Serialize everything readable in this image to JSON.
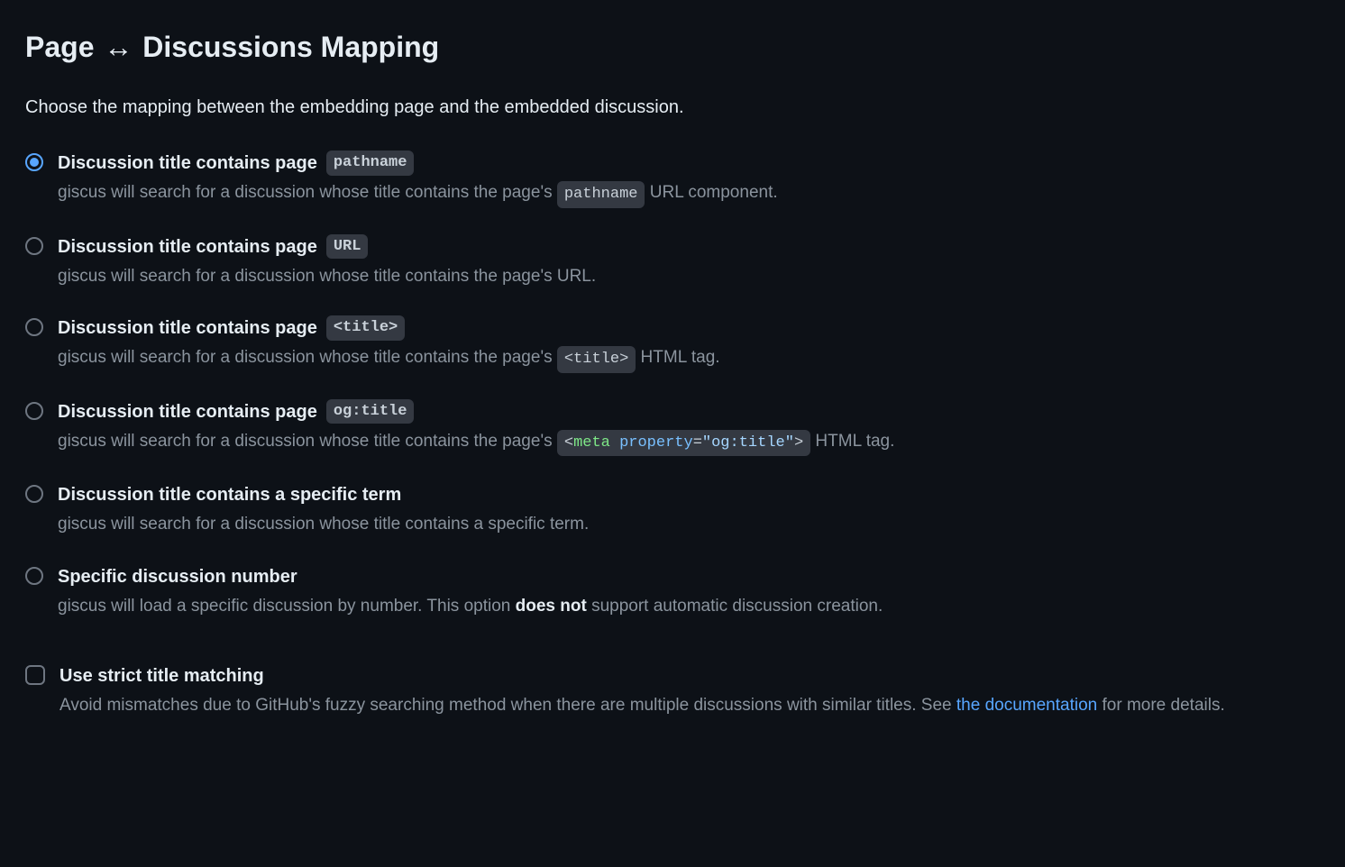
{
  "heading": {
    "prefix": "Page",
    "arrow": "↔",
    "suffix": "Discussions Mapping"
  },
  "subtitle": "Choose the mapping between the embedding page and the embedded discussion.",
  "options": [
    {
      "checked": true,
      "title_text": "Discussion title contains page",
      "title_code": "pathname",
      "desc_before": "giscus will search for a discussion whose title contains the page's ",
      "desc_code": "pathname",
      "desc_after": " URL component."
    },
    {
      "checked": false,
      "title_text": "Discussion title contains page",
      "title_code": "URL",
      "desc_plain": "giscus will search for a discussion whose title contains the page's URL."
    },
    {
      "checked": false,
      "title_text": "Discussion title contains page",
      "title_code": "<title>",
      "desc_before": "giscus will search for a discussion whose title contains the page's ",
      "desc_code": "<title>",
      "desc_after": " HTML tag."
    },
    {
      "checked": false,
      "title_text": "Discussion title contains page",
      "title_code": "og:title",
      "desc_before": "giscus will search for a discussion whose title contains the page's ",
      "desc_code_html": {
        "open": "<",
        "tag": "meta",
        "attr": "property",
        "eq": "=",
        "val": "\"og:title\"",
        "close": ">"
      },
      "desc_after": " HTML tag."
    },
    {
      "checked": false,
      "title_text_only": "Discussion title contains a specific term",
      "desc_plain": "giscus will search for a discussion whose title contains a specific term."
    },
    {
      "checked": false,
      "title_text_only": "Specific discussion number",
      "desc_before_plain": "giscus will load a specific discussion by number. This option ",
      "desc_strong": "does not",
      "desc_after_plain": " support automatic discussion creation."
    }
  ],
  "strict": {
    "title": "Use strict title matching",
    "desc_before": "Avoid mismatches due to GitHub's fuzzy searching method when there are multiple discussions with similar titles. See ",
    "link_text": "the documentation",
    "desc_after": " for more details."
  }
}
